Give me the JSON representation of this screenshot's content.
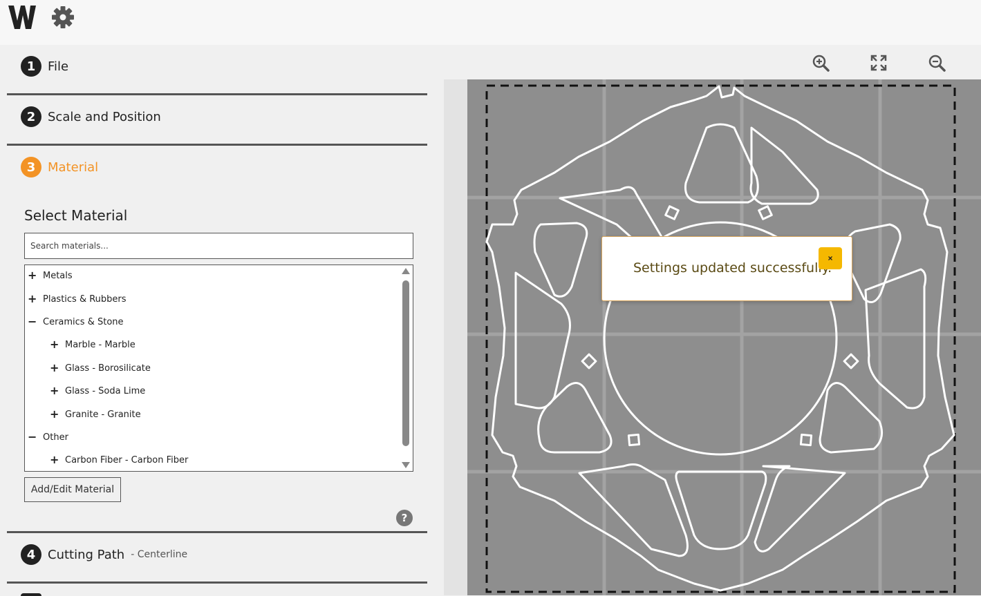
{
  "app": {
    "logo_icon": "w-logo-icon",
    "settings_icon": "gear-icon"
  },
  "steps": [
    {
      "number": "1",
      "title": "File",
      "subtitle": ""
    },
    {
      "number": "2",
      "title": "Scale and Position",
      "subtitle": ""
    },
    {
      "number": "3",
      "title": "Material",
      "subtitle": ""
    },
    {
      "number": "4",
      "title": "Cutting Path",
      "subtitle": "- Centerline"
    }
  ],
  "material": {
    "heading": "Select Material",
    "search_placeholder": "Search materials...",
    "tree": [
      {
        "label": "Metals",
        "toggle": "+",
        "level": 0
      },
      {
        "label": "Plastics & Rubbers",
        "toggle": "+",
        "level": 0
      },
      {
        "label": "Ceramics & Stone",
        "toggle": "−",
        "level": 0
      },
      {
        "label": "Marble - Marble",
        "toggle": "+",
        "level": 1
      },
      {
        "label": "Glass - Borosilicate",
        "toggle": "+",
        "level": 1
      },
      {
        "label": "Glass - Soda Lime",
        "toggle": "+",
        "level": 1
      },
      {
        "label": "Granite - Granite",
        "toggle": "+",
        "level": 1
      },
      {
        "label": "Other",
        "toggle": "−",
        "level": 0
      },
      {
        "label": "Carbon Fiber - Carbon Fiber",
        "toggle": "+",
        "level": 1
      }
    ],
    "add_edit_button": "Add/Edit Material",
    "help_label": "?"
  },
  "toolbar": {
    "zoom_in_icon": "zoom-in-icon",
    "fit_icon": "fit-screen-icon",
    "zoom_out_icon": "zoom-out-icon"
  },
  "toast": {
    "message": "Settings updated successfully.",
    "close_label": "×"
  },
  "colors": {
    "accent": "#f39325",
    "canvas_bed": "#8e8e8e",
    "toast_close": "#f5b800"
  }
}
